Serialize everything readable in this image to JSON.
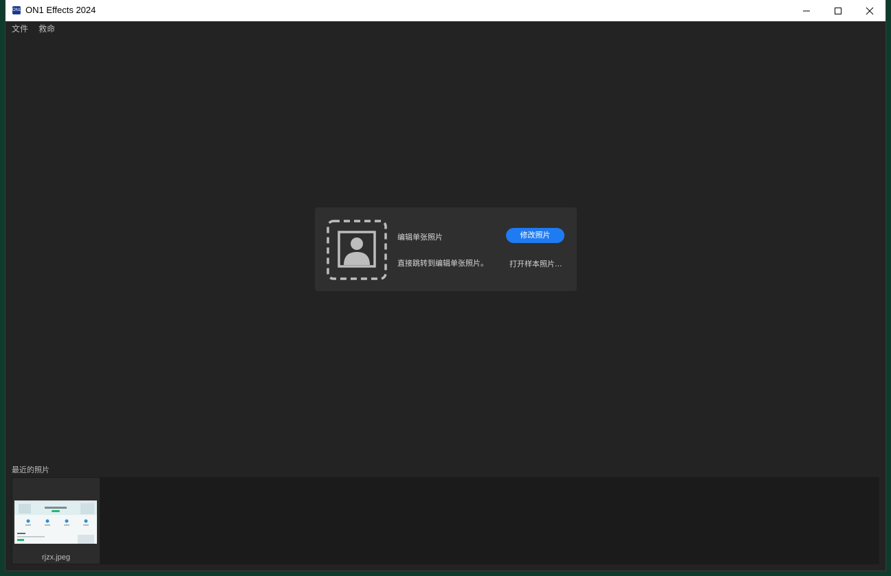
{
  "window": {
    "title": "ON1 Effects 2024",
    "icon": "on1-app-icon",
    "controls": [
      "minimize-icon",
      "maximize-icon",
      "close-icon"
    ]
  },
  "menu": {
    "file": "文件",
    "help": "救命"
  },
  "start_card": {
    "title": "编辑单张照片",
    "description": "直接跳转到编辑单张照片。",
    "edit_button": "修改照片",
    "sample_link": "打开样本照片...",
    "icon": "photo-placeholder-icon"
  },
  "recent": {
    "label": "最近的照片",
    "items": [
      {
        "filename": "rjzx.jpeg"
      }
    ]
  },
  "colors": {
    "background": "#232323",
    "card": "#2f2f2f",
    "accent": "#1e7bf2",
    "titlebar": "#ffffff"
  }
}
